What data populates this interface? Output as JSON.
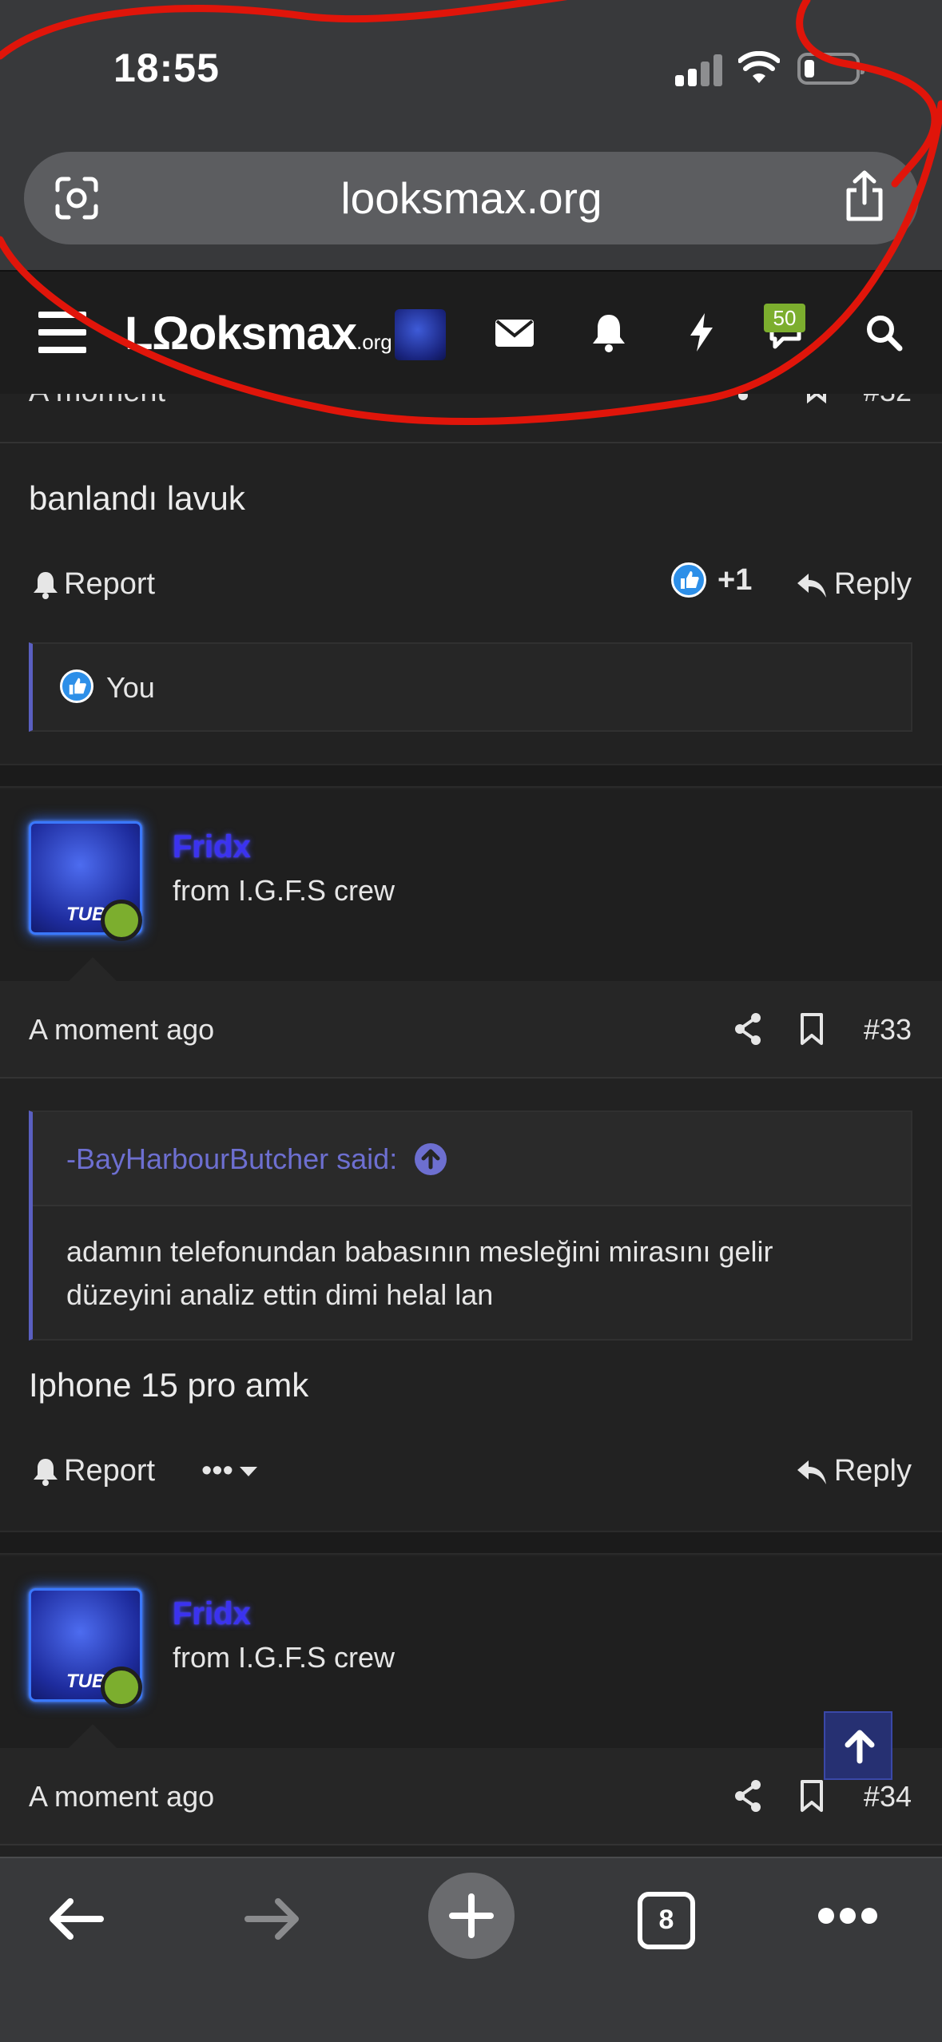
{
  "status_bar": {
    "time": "18:55"
  },
  "browser": {
    "url": "looksmax.org",
    "tab_count": "8"
  },
  "forum_nav": {
    "logo_main": "LΩoksmax",
    "logo_suffix": ".org",
    "badge_count": "50"
  },
  "partial_post": {
    "time": "A moment",
    "number": "#32"
  },
  "post32": {
    "body": "banlandı lavuk",
    "report_label": "Report",
    "reaction_count": "+1",
    "reply_label": "Reply",
    "reacted_by": "You"
  },
  "post33": {
    "username": "Fridx",
    "user_title": "from I.G.F.S crew",
    "avatar_text": "TUBE",
    "time": "A moment ago",
    "number": "#33",
    "quote_author": "-BayHarbourButcher said:",
    "quote_text": "adamın telefonundan babasının mesleğini mirasını gelir düzeyini analiz ettin dimi helal lan",
    "body": "Iphone 15 pro amk",
    "report_label": "Report",
    "more_label": "•••",
    "reply_label": "Reply"
  },
  "post34": {
    "username": "Fridx",
    "user_title": "from I.G.F.S crew",
    "avatar_text": "TUBE",
    "time": "A moment ago",
    "number": "#34"
  },
  "colors": {
    "accent": "#5a5fc0",
    "username": "#3b32f0",
    "online": "#7cae2e",
    "annotation": "#e0150a"
  }
}
